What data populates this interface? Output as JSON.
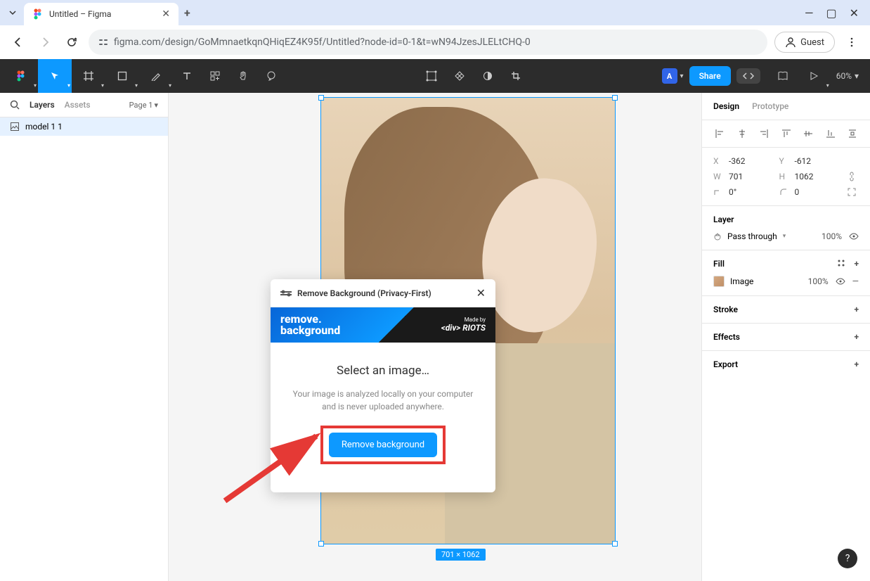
{
  "browser": {
    "tab_title": "Untitled – Figma",
    "url": "figma.com/design/GoMmnaetkqnQHiqEZ4K95f/Untitled?node-id=0-1&t=wN94JzesJLELtCHQ-0",
    "guest_label": "Guest"
  },
  "toolbar": {
    "share_label": "Share",
    "zoom": "60%"
  },
  "left_panel": {
    "tab_layers": "Layers",
    "tab_assets": "Assets",
    "page_label": "Page 1",
    "layer_name": "model 1 1"
  },
  "canvas": {
    "dimensions": "701 × 1062"
  },
  "plugin": {
    "title": "Remove Background (Privacy-First)",
    "banner_name": "remove.\nbackground",
    "banner_madeby": "Made by",
    "banner_brand": "<div> RIOTS",
    "heading": "Select an image…",
    "desc": "Your image is analyzed locally on your computer and is never uploaded anywhere.",
    "button": "Remove background"
  },
  "right_panel": {
    "tab_design": "Design",
    "tab_prototype": "Prototype",
    "x": "-362",
    "y": "-612",
    "w": "701",
    "h": "1062",
    "rotation": "0°",
    "corner": "0",
    "layer_label": "Layer",
    "blend_mode": "Pass through",
    "layer_opacity": "100%",
    "fill_label": "Fill",
    "fill_type": "Image",
    "fill_opacity": "100%",
    "stroke_label": "Stroke",
    "effects_label": "Effects",
    "export_label": "Export"
  }
}
